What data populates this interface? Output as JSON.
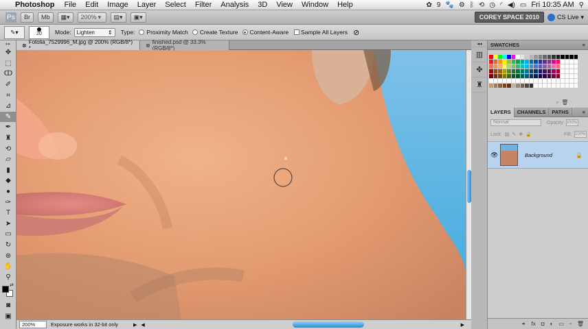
{
  "menubar": {
    "app_name": "Photoshop",
    "items": [
      "File",
      "Edit",
      "Image",
      "Layer",
      "Select",
      "Filter",
      "Analysis",
      "3D",
      "View",
      "Window",
      "Help"
    ],
    "status_number": "9",
    "clock": "Fri 10:35 AM"
  },
  "appbar": {
    "logo": "Ps",
    "zoom_value": "200%",
    "workspace": "COREY SPACE 2010",
    "cs_live": "CS Live"
  },
  "options": {
    "brush_size": "20",
    "mode_label": "Mode:",
    "mode_value": "Lighten",
    "type_label": "Type:",
    "type_options": [
      "Proximity Match",
      "Create Texture",
      "Content-Aware"
    ],
    "selected_type": "Content-Aware",
    "sample_all_layers": "Sample All Layers"
  },
  "doctabs": {
    "active": "Fotolia_7529996_M.jpg @ 200% (RGB/8*) *",
    "inactive": "finished.psd @ 33.3% (RGB/8*)",
    "close_glyph": "⊗"
  },
  "status": {
    "zoom": "200%",
    "message": "Exposure works in 32-bit only"
  },
  "swatches": {
    "title": "SWATCHES",
    "colors": [
      "#ff0000",
      "#ffff00",
      "#00ff00",
      "#00ffff",
      "#0000ff",
      "#ff00ff",
      "#ffffff",
      "#e6e6e6",
      "#cccccc",
      "#b3b3b3",
      "#999999",
      "#808080",
      "#666666",
      "#4d4d4d",
      "#333333",
      "#1a1a1a",
      "#000000",
      "#000000",
      "#000000",
      "#000000",
      "#ed1c24",
      "#f26522",
      "#f7941d",
      "#fff200",
      "#8dc63f",
      "#39b54a",
      "#00a651",
      "#00a99d",
      "#00aeef",
      "#0072bc",
      "#0054a6",
      "#2e3192",
      "#662d91",
      "#92278f",
      "#ec008c",
      "#ed145b",
      "#ffffff",
      "#ffffff",
      "#ffffff",
      "#ffffff",
      "#f26c4f",
      "#f68e56",
      "#fbaf5d",
      "#fff568",
      "#acd373",
      "#7cc576",
      "#3bb878",
      "#1abbb4",
      "#00bff3",
      "#438ccb",
      "#5574b9",
      "#605ca8",
      "#8560a8",
      "#a864a8",
      "#f06eaa",
      "#f26d7d",
      "#ffffff",
      "#ffffff",
      "#ffffff",
      "#ffffff",
      "#9e0b0f",
      "#a0410d",
      "#a36209",
      "#aba000",
      "#598527",
      "#197b30",
      "#007236",
      "#00746b",
      "#0076a3",
      "#004a80",
      "#003471",
      "#1b1464",
      "#440e62",
      "#630460",
      "#9e005d",
      "#9e0039",
      "#ffffff",
      "#ffffff",
      "#ffffff",
      "#ffffff",
      "#790000",
      "#7b2e00",
      "#7d4900",
      "#827b00",
      "#406618",
      "#005e20",
      "#005826",
      "#005952",
      "#005b7f",
      "#003663",
      "#002157",
      "#0d004c",
      "#32004b",
      "#4b0049",
      "#7b0046",
      "#7a0026",
      "#ffffff",
      "#ffffff",
      "#ffffff",
      "#ffffff",
      "#ffffff",
      "#ffffff",
      "#ffffff",
      "#ffffff",
      "#ffffff",
      "#ffffff",
      "#ffffff",
      "#ffffff",
      "#ffffff",
      "#ffffff",
      "#ffffff",
      "#ffffff",
      "#ffffff",
      "#ffffff",
      "#ffffff",
      "#ffffff",
      "#ffffff",
      "#ffffff",
      "#ffffff",
      "#ffffff",
      "#c69c6d",
      "#a67c52",
      "#8c6239",
      "#754c24",
      "#603913",
      "#c7b299",
      "#998675",
      "#736357",
      "#534741",
      "#362f2d",
      "#ffffff",
      "#ffffff",
      "#ffffff",
      "#ffffff",
      "#ffffff",
      "#ffffff",
      "#ffffff",
      "#ffffff",
      "#ffffff",
      "#ffffff"
    ]
  },
  "layers": {
    "tabs": [
      "LAYERS",
      "CHANNELS",
      "PATHS"
    ],
    "blend_mode": "Normal",
    "opacity_label": "Opacity:",
    "opacity_value": "100%",
    "lock_label": "Lock:",
    "fill_label": "Fill:",
    "fill_value": "100%",
    "layer_name": "Background"
  }
}
